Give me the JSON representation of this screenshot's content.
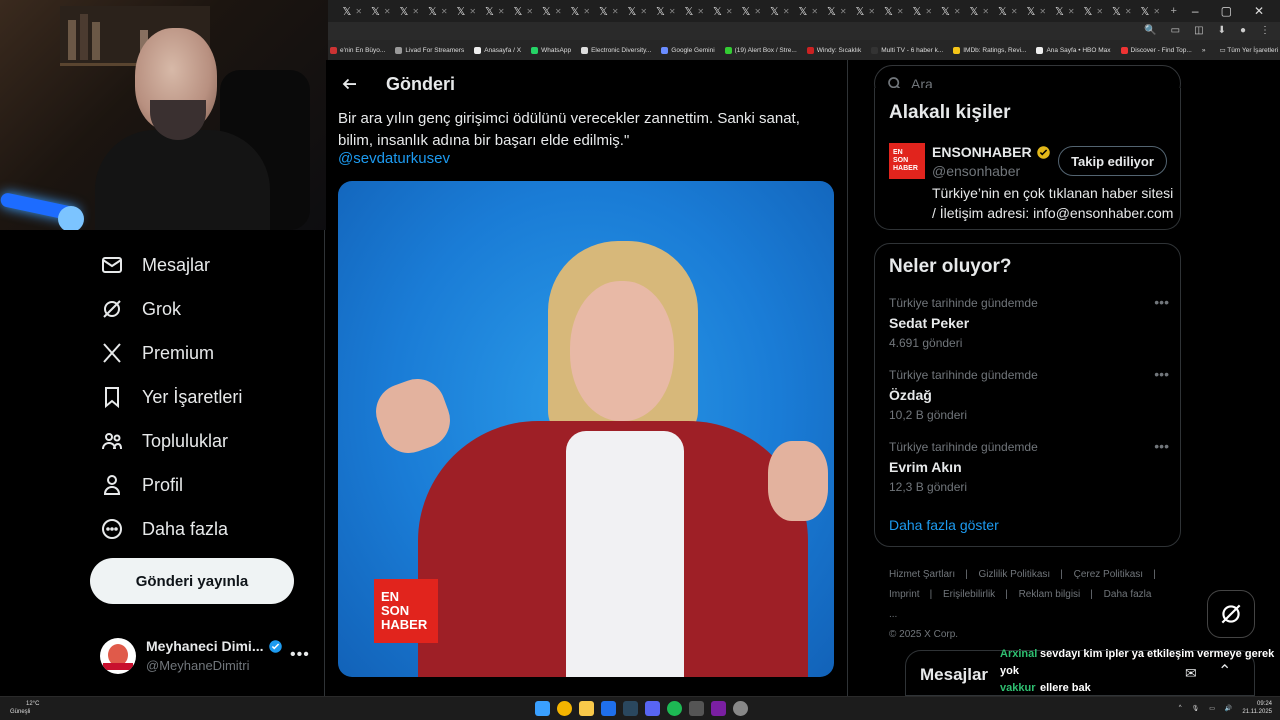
{
  "browser": {
    "tab_glyphs": [
      "𝕏",
      "𝕏",
      "𝕏",
      "𝕏",
      "𝕏",
      "𝕏",
      "𝕏",
      "𝕏",
      "𝕏",
      "𝕏",
      "𝕏",
      "𝕏",
      "𝕏",
      "𝕏",
      "𝕏",
      "𝕏",
      "𝕏",
      "𝕏",
      "𝕏",
      "𝕏",
      "𝕏",
      "𝕏",
      "𝕏",
      "𝕏",
      "𝕏",
      "𝕏",
      "𝕏",
      "𝕏",
      "𝕏"
    ],
    "bookmarks": [
      {
        "label": "e'nin En Büyo...",
        "color": "#c33"
      },
      {
        "label": "Livad For Streamers",
        "color": "#999"
      },
      {
        "label": "Anasayfa / X",
        "color": "#eee"
      },
      {
        "label": "WhatsApp",
        "color": "#25d366"
      },
      {
        "label": "Electronic Diversity...",
        "color": "#ddd"
      },
      {
        "label": "Google Gemini",
        "color": "#6a8cff"
      },
      {
        "label": "(19) Alert Box / Stre...",
        "color": "#3c3"
      },
      {
        "label": "Windy: Sıcaklık",
        "color": "#c22"
      },
      {
        "label": "Multi TV - 6 haber k...",
        "color": "#333"
      },
      {
        "label": "IMDb: Ratings, Revi...",
        "color": "#f5c518"
      },
      {
        "label": "Ana Sayfa • HBO Max",
        "color": "#eee"
      },
      {
        "label": "Discover - Find Top...",
        "color": "#e33"
      }
    ],
    "all_bookmarks_label": "Tüm Yer İşaretleri"
  },
  "nav": {
    "items": [
      {
        "label": "Mesajlar",
        "icon": "envelope-icon"
      },
      {
        "label": "Grok",
        "icon": "grok-icon"
      },
      {
        "label": "Premium",
        "icon": "x-logo-icon"
      },
      {
        "label": "Yer İşaretleri",
        "icon": "bookmark-icon"
      },
      {
        "label": "Topluluklar",
        "icon": "communities-icon"
      },
      {
        "label": "Profil",
        "icon": "person-icon"
      },
      {
        "label": "Daha fazla",
        "icon": "more-circle-icon"
      }
    ],
    "post_button": "Gönderi yayınla",
    "profile": {
      "name": "Meyhaneci Dimi...",
      "handle": "@MeyhaneDimitri"
    }
  },
  "main": {
    "title": "Gönderi",
    "tweet_text": "Bir ara yılın genç girişimci ödülünü verecekler zannettim. Sanki sanat, bilim, insanlık adına bir başarı elde edilmiş.\"",
    "mention": "@sevdaturkusev",
    "video_logo": [
      "EN",
      "SON",
      "HABER"
    ]
  },
  "search": {
    "placeholder": "Ara"
  },
  "related": {
    "title": "Alakalı kişiler",
    "account": {
      "name": "ENSONHABER",
      "handle": "@ensonhaber",
      "bio": "Türkiye’nin en çok tıklanan haber sitesi / İletişim adresi: info@ensonhaber.com",
      "follow_label": "Takip ediliyor",
      "logo": [
        "EN",
        "SON",
        "HABER"
      ]
    }
  },
  "trends": {
    "title": "Neler oluyor?",
    "items": [
      {
        "context": "Türkiye tarihinde gündemde",
        "name": "Sedat Peker",
        "count": "4.691 gönderi"
      },
      {
        "context": "Türkiye tarihinde gündemde",
        "name": "Özdağ",
        "count": "10,2 B gönderi"
      },
      {
        "context": "Türkiye tarihinde gündemde",
        "name": "Evrim Akın",
        "count": "12,3 B gönderi"
      }
    ],
    "show_more": "Daha fazla göster"
  },
  "footer": {
    "links": [
      "Hizmet Şartları",
      "Gizlilik Politikası",
      "Çerez Politikası",
      "Imprint",
      "Erişilebilirlik",
      "Reklam bilgisi",
      "Daha fazla ..."
    ],
    "copyright": "© 2025 X Corp."
  },
  "messages_dock": {
    "title": "Mesajlar"
  },
  "chat_overlay": [
    {
      "user": "Arxinal",
      "message": "sevdayı kim ipler ya etkileşim vermeye gerek yok"
    },
    {
      "user": "vakkur",
      "message": "ellere bak"
    }
  ],
  "taskbar": {
    "weather_temp": "12°C",
    "weather_desc": "Güneşli",
    "time": "09:24",
    "date": "21.11.2025"
  },
  "colors": {
    "accent": "#1d9bf0",
    "background": "#000000",
    "verified": "#1d9bf0",
    "gold_verified": "#e2b719"
  }
}
